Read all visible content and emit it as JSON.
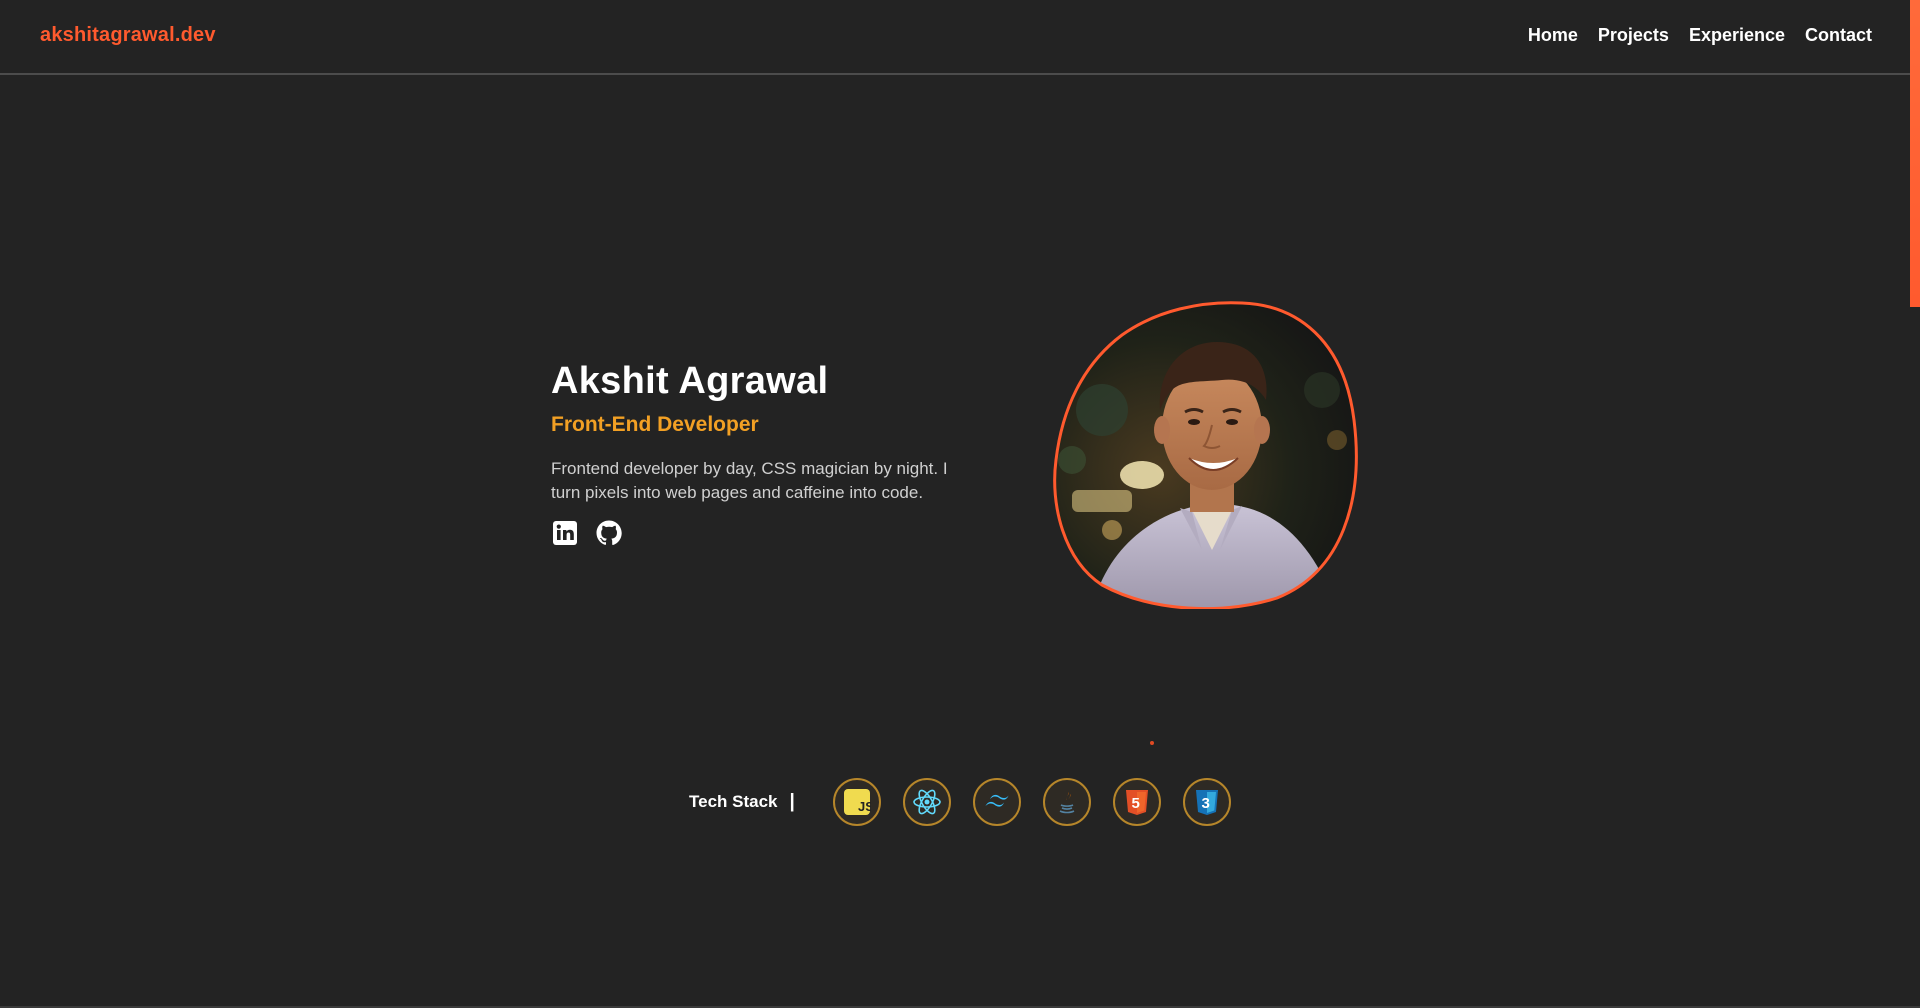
{
  "header": {
    "logo": "akshitagrawal.dev",
    "nav": [
      {
        "label": "Home"
      },
      {
        "label": "Projects"
      },
      {
        "label": "Experience"
      },
      {
        "label": "Contact"
      }
    ]
  },
  "hero": {
    "name": "Akshit Agrawal",
    "role": "Front-End Developer",
    "description": "Frontend developer by day, CSS magician by night. I turn pixels into web pages and caffeine into code.",
    "socials": [
      {
        "icon": "linkedin-icon"
      },
      {
        "icon": "github-icon"
      }
    ],
    "avatar_icon": "profile-photo"
  },
  "tech_stack": {
    "label": "Tech Stack",
    "separator": "|",
    "items": [
      {
        "icon": "javascript-icon",
        "text": "JS",
        "color": "#f0db4f"
      },
      {
        "icon": "react-icon",
        "color": "#61dafb"
      },
      {
        "icon": "tailwind-icon",
        "color": "#38bdf8"
      },
      {
        "icon": "java-icon",
        "color": "#e76f00"
      },
      {
        "icon": "html5-icon",
        "text": "5",
        "color": "#e34f26"
      },
      {
        "icon": "css3-icon",
        "text": "3",
        "color": "#1572b6"
      }
    ]
  },
  "colors": {
    "background": "#232323",
    "accent": "#ff5a2e",
    "role": "#f2a024",
    "icon_ring": "#b6862a"
  }
}
